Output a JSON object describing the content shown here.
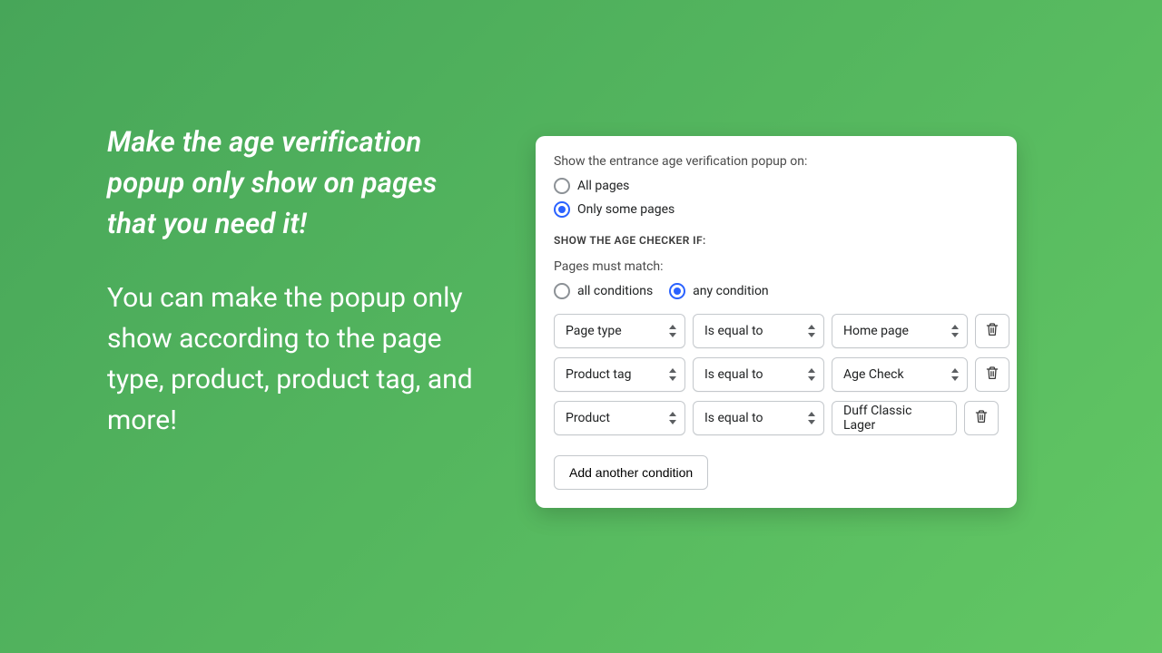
{
  "marketing": {
    "headline": "Make the age verification popup only show on pages that you need it!",
    "subtext": "You can make the popup only show according to the page type, product, product tag, and more!"
  },
  "panel": {
    "show_on_label": "Show the entrance age verification popup on:",
    "radio_all_pages": "All pages",
    "radio_some_pages": "Only some pages",
    "show_on_selected": "some",
    "section_heading": "SHOW THE AGE CHECKER IF:",
    "match_label": "Pages must match:",
    "radio_all_conditions": "all conditions",
    "radio_any_condition": "any condition",
    "match_selected": "any",
    "conditions": [
      {
        "field": "Page type",
        "operator": "Is equal to",
        "value": "Home page",
        "value_is_select": true
      },
      {
        "field": "Product tag",
        "operator": "Is equal to",
        "value": "Age Check",
        "value_is_select": true
      },
      {
        "field": "Product",
        "operator": "Is equal to",
        "value": "Duff Classic Lager",
        "value_is_select": false
      }
    ],
    "add_condition_label": "Add another condition"
  },
  "icons": {
    "trash": "trash-icon",
    "stepper": "stepper-icon"
  }
}
